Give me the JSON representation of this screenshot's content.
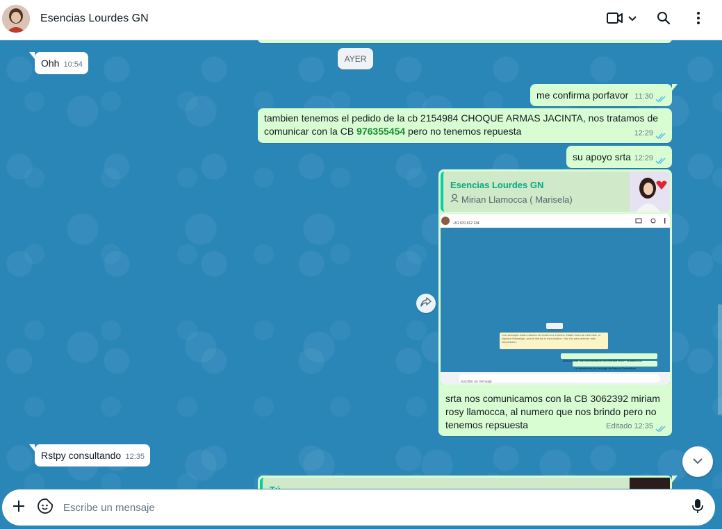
{
  "header": {
    "contact_name": "Esencias Lourdes GN",
    "icons": [
      "avatar",
      "video-call-icon",
      "chevron-down-icon",
      "search-icon",
      "menu-dots-icon"
    ]
  },
  "chat": {
    "date_separator": "AYER",
    "messages": [
      {
        "direction": "in",
        "text": "Ohh",
        "time": "10:54"
      },
      {
        "direction": "out",
        "text": "me confirma porfavor",
        "time": "11:30",
        "status": "read"
      },
      {
        "direction": "out",
        "text_before": "tambien tenemos el pedido de la cb 2154984 CHOQUE ARMAS JACINTA, nos tratamos de comunicar con la CB ",
        "phone": "976355454",
        "text_after": " pero no tenemos repuesta",
        "time": "12:29",
        "status": "read"
      },
      {
        "direction": "out",
        "text": "su apoyo srta",
        "time": "12:29",
        "status": "read"
      },
      {
        "direction": "out",
        "quoted_name": "Esencias Lourdes GN",
        "quoted_author": "Mirian Llamocca ( Marisela)",
        "screenshot": {
          "header_text": "+51 970 612 234",
          "date": "SÁBADO",
          "system_notice": "Los mensajes están cifrados de extremo a extremo. Nadie fuera de este chat, ni siquiera WhatsApp, puede leerlos ni escucharlos. Haz clic para obtener más información.",
          "msg1": "Buenos días nos comunicamos con MIRIAN ROSY LLAMOCCA",
          "msg2": "Le saludamos por encargo de Natura Cosmeticos",
          "input_placeholder": "Escribe un mensaje"
        },
        "text": "srta nos comunicamos con la CB 3062392 miriam rosy llamocca, al numero que nos brindo pero no tenemos repsuesta",
        "edited_label": "Editado",
        "time": "12:35",
        "status": "read"
      },
      {
        "direction": "in",
        "text": "Rstpy consultando",
        "time": "12:35"
      },
      {
        "direction": "out",
        "quoted_name": "Tú"
      }
    ]
  },
  "composer": {
    "placeholder": "Escribe un mensaje"
  },
  "colors": {
    "wallpaper": "#2b86b8",
    "outgoing_bubble": "#d9fdd3",
    "incoming_bubble": "#ffffff",
    "read_ticks": "#53bdeb",
    "quote_accent": "#06cf9c"
  }
}
